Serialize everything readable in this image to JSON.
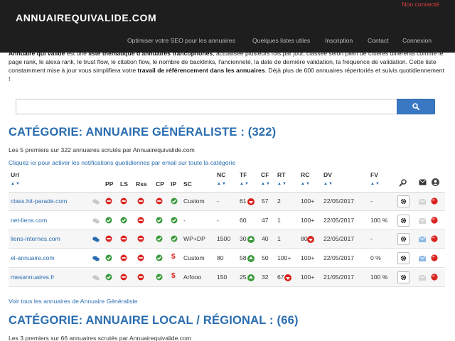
{
  "header": {
    "brand": "ANNUAIREQUIVALIDE.COM",
    "status": "Non connecté",
    "nav": [
      {
        "label": "Optimiser votre SEO pour les annuaires"
      },
      {
        "label": "Quelques listes utiles"
      },
      {
        "label": "Inscription"
      },
      {
        "label": "Contact"
      },
      {
        "label": "Connexion"
      }
    ]
  },
  "intro": {
    "p1": "Annuaire qui valide",
    "p2": " est une ",
    "p3": "liste thématique d'annuaires francophones",
    "p4": ", actualisée plusieurs fois par jour, classée selon plein de critères différents comme le page rank, le alexa rank, le trust flow, le citation flow, le nombre de backlinks, l'ancienneté, la date de dernière validation, la fréquence de validation. Cette liste constamment mise à jour vous simplifiera votre ",
    "p5": "travail de référencement dans les annuaires",
    "p6": ". Déjà plus de 600 annuaires répertoriés et suivis quotidiennement !"
  },
  "search": {
    "value": "",
    "placeholder": ""
  },
  "category1": {
    "title": "CATÉGORIE: ANNUAIRE GÉNÉRALISTE : (322)",
    "subtitle": "Les 5 premiers sur 322 annuaires scrutés par Annuairequivalide.com",
    "notify_link": "Cliquez ici pour activer les notifications quotidiennes par email sur toute la catégorie",
    "all_link": "Voir tous les annuaires de Annuaire Généraliste"
  },
  "columns": {
    "url": "Url",
    "pp": "PP",
    "ls": "LS",
    "rss": "Rss",
    "cp": "CP",
    "ip": "IP",
    "sc": "SC",
    "nc": "NC",
    "tf": "TF",
    "cf": "CF",
    "rt": "RT",
    "rc": "RC",
    "dv": "DV",
    "fv": "FV",
    "sort_arrows": "▲▼"
  },
  "rows": [
    {
      "url": "class.hit-parade.com",
      "comment": "grey",
      "pp": "red",
      "ls": "red",
      "rss": "red",
      "cp": "red",
      "ip": "green",
      "ip_type": "circle",
      "sc": "Custom",
      "nc": "-",
      "tf": "61",
      "tf_dir": "down",
      "cf": "57",
      "rt": "2",
      "rc": "100+",
      "rc_dir": "",
      "dv": "22/05/2017",
      "fv": "-",
      "mail": "grey"
    },
    {
      "url": "net-liens.com",
      "comment": "grey",
      "pp": "green",
      "ls": "green",
      "rss": "red",
      "cp": "green",
      "ip": "green",
      "ip_type": "circle",
      "sc": "-",
      "nc": "-",
      "tf": "60",
      "tf_dir": "",
      "cf": "47",
      "rt": "1",
      "rc": "100+",
      "rc_dir": "",
      "dv": "22/05/2017",
      "fv": "100 %",
      "mail": "grey"
    },
    {
      "url": "liens-internes.com",
      "comment": "blue",
      "pp": "red",
      "ls": "red",
      "rss": "red",
      "cp": "green",
      "ip": "green",
      "ip_type": "circle",
      "sc": "WP+DP",
      "nc": "1500",
      "tf": "30",
      "tf_dir": "up",
      "cf": "40",
      "rt": "1",
      "rc": "80",
      "rc_dir": "down",
      "dv": "22/05/2017",
      "fv": "-",
      "mail": "blue"
    },
    {
      "url": "el-annuaire.com",
      "comment": "blue",
      "pp": "green",
      "ls": "red",
      "rss": "red",
      "cp": "green",
      "ip": "red",
      "ip_type": "dollar",
      "sc": "Custom",
      "nc": "80",
      "tf": "58",
      "tf_dir": "up",
      "cf": "50",
      "rt": "100+",
      "rc": "100+",
      "rc_dir": "",
      "dv": "22/05/2017",
      "fv": "0 %",
      "mail": "blue"
    },
    {
      "url": "mesannuaires.fr",
      "comment": "grey",
      "pp": "green",
      "ls": "red",
      "rss": "red",
      "cp": "green",
      "ip": "red",
      "ip_type": "dollar",
      "sc": "Arfooo",
      "nc": "150",
      "tf": "25",
      "tf_dir": "up",
      "cf": "32",
      "rt": "67",
      "rt_dir": "down",
      "rc": "100+",
      "rc_dir": "",
      "dv": "21/05/2017",
      "fv": "100 %",
      "mail": "grey"
    }
  ],
  "ip_dollar": "$",
  "category2": {
    "title": "CATÉGORIE: ANNUAIRE LOCAL / RÉGIONAL : (66)",
    "subtitle": "Les 3 premiers sur 66 annuaires scrutés par Annuairequivalide.com"
  },
  "colors": {
    "red": "#d9231e",
    "green": "#3c9a3c",
    "blue": "#2a6db0",
    "grey": "#c8c8c8"
  }
}
